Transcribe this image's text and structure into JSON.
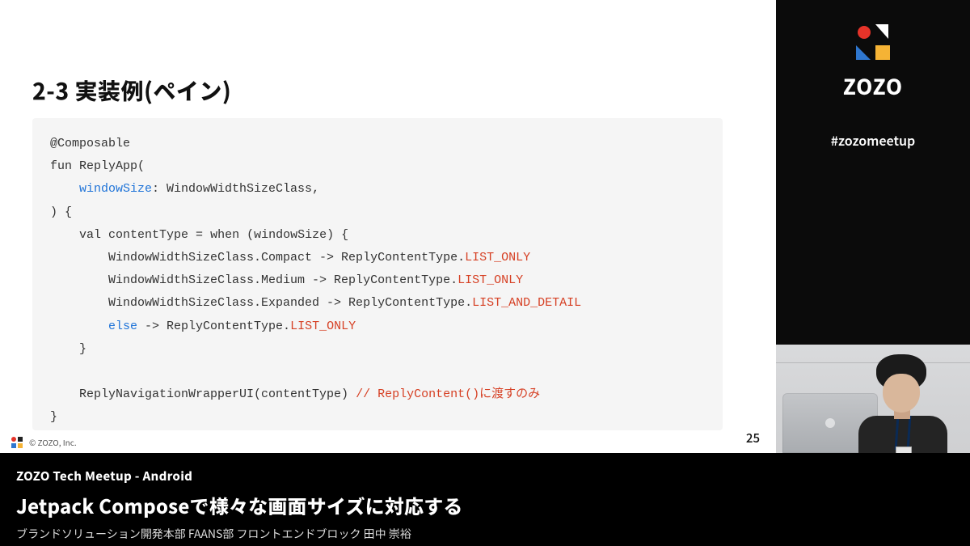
{
  "slide": {
    "heading": "2-3 実装例(ペイン)",
    "page_number": "25",
    "footer_copyright": "© ZOZO, Inc.",
    "code": {
      "l1": "@Composable",
      "l2a": "fun",
      "l2b": " ReplyApp(",
      "l3a": "    ",
      "l3param": "windowSize",
      "l3b": ": WindowWidthSizeClass,",
      "l4": ") {",
      "l5a": "    ",
      "l5kw": "val",
      "l5b": " contentType = ",
      "l5kw2": "when",
      "l5c": " (windowSize) {",
      "l6a": "        WindowWidthSizeClass.Compact -> ReplyContentType.",
      "l6b": "LIST_ONLY",
      "l7a": "        WindowWidthSizeClass.Medium -> ReplyContentType.",
      "l7b": "LIST_ONLY",
      "l8a": "        WindowWidthSizeClass.Expanded -> ReplyContentType.",
      "l8b": "LIST_AND_DETAIL",
      "l9a": "        ",
      "l9kw": "else",
      "l9b": " -> ReplyContentType.",
      "l9c": "LIST_ONLY",
      "l10": "    }",
      "l11": "",
      "l12a": "    ReplyNavigationWrapperUI(contentType) ",
      "l12b": "// ReplyContent()に渡すのみ",
      "l13": "}"
    }
  },
  "brand": {
    "name": "ZOZO",
    "hashtag": "#zozomeetup"
  },
  "footer": {
    "event": "ZOZO Tech Meetup - Android",
    "title": "Jetpack Composeで様々な画面サイズに対応する",
    "byline": "ブランドソリューション開発本部 FAANS部 フロントエンドブロック 田中 崇裕"
  }
}
